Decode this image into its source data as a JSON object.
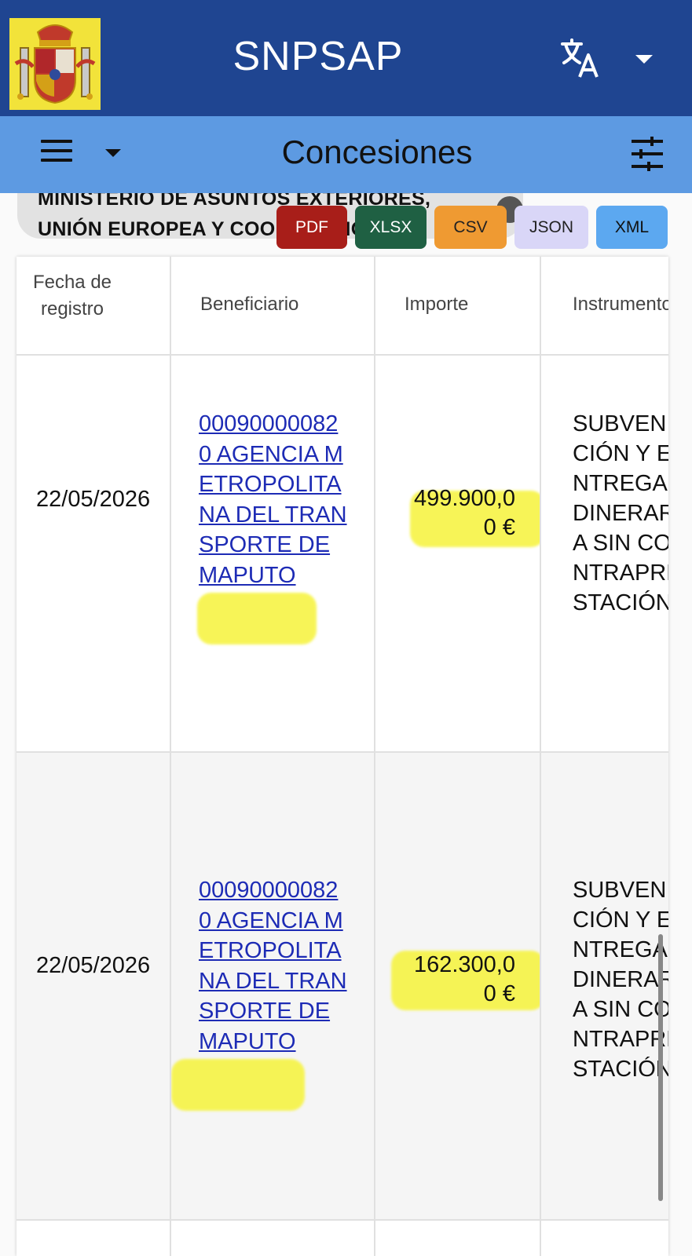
{
  "header": {
    "app_title": "SNPSAP",
    "logo_icon": "spain-coat-of-arms",
    "language_icon": "translate-icon"
  },
  "subheader": {
    "menu_icon": "hamburger-menu-icon",
    "section_title": "Concesiones",
    "filter_icon": "tune-sliders-icon"
  },
  "filter_chip": {
    "text": "MINISTERIO DE ASUNTOS EXTERIORES, UNIÓN EUROPEA Y COOPERACIÓN"
  },
  "export_buttons": {
    "pdf": "PDF",
    "xlsx": "XLSX",
    "csv": "CSV",
    "json": "JSON",
    "xml": "XML"
  },
  "table": {
    "headers": {
      "fecha": "Fecha de registro",
      "beneficiario": "Beneficiario",
      "importe": "Importe",
      "instrumento": "Instrumento"
    },
    "rows": [
      {
        "fecha": "22/05/2026",
        "beneficiario": "000900000820 AGENCIA METROPOLITANA DEL TRANSPORTE DE MAPUTO",
        "importe": "499.900,00 €",
        "instrumento": "SUBVENCIÓN y ENTREGA DINERARIA SIN CONTRAPRESTACIÓN"
      },
      {
        "fecha": "22/05/2026",
        "beneficiario": "000900000820 AGENCIA METROPOLITANA DEL TRANSPORTE DE MAPUTO",
        "importe": "162.300,00 €",
        "instrumento": "SUBVENCIÓN y ENTREGA DINERARIA SIN CONTRAPRESTACIÓN"
      }
    ]
  },
  "colors": {
    "header_bg": "#1f4591",
    "subheader_bg": "#5d9ae2",
    "link": "#1d2bb5",
    "highlight": "#f6f33a"
  }
}
